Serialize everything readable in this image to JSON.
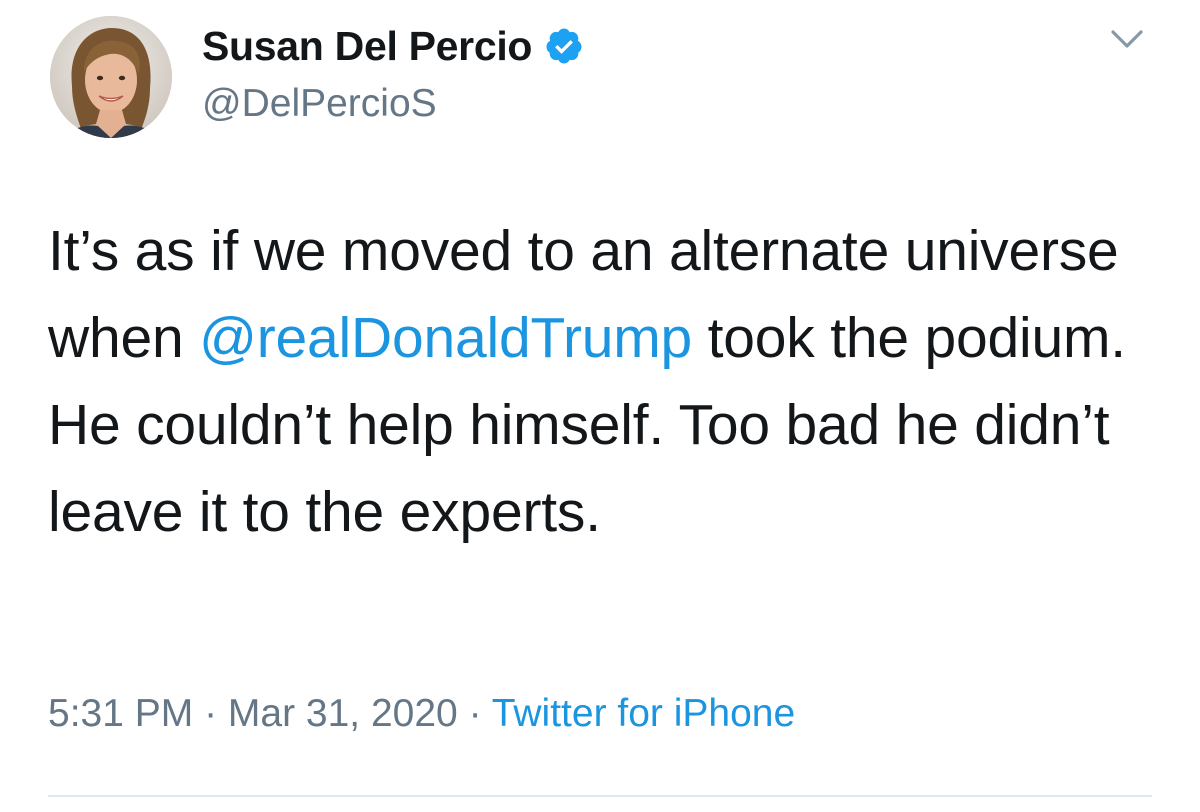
{
  "author": {
    "display_name": "Susan Del Percio",
    "handle": "@DelPercioS",
    "verified_icon": "verified-badge-icon",
    "avatar_icon": "profile-photo"
  },
  "tweet": {
    "text_before_mention": "It’s as if we moved to an alternate universe when ",
    "mention": "@realDonaldTrump",
    "text_after_mention": " took the podium. He couldn’t help himself. Too bad he didn’t leave it to the experts."
  },
  "meta": {
    "time": "5:31 PM",
    "separator1": " · ",
    "date": "Mar 31, 2020",
    "separator2": " · ",
    "source": "Twitter for iPhone"
  },
  "menu": {
    "caret_icon": "chevron-down-icon"
  },
  "colors": {
    "link": "#1b95e0",
    "secondary_text": "#657786",
    "primary_text": "#14171a",
    "verified": "#1da1f2"
  }
}
